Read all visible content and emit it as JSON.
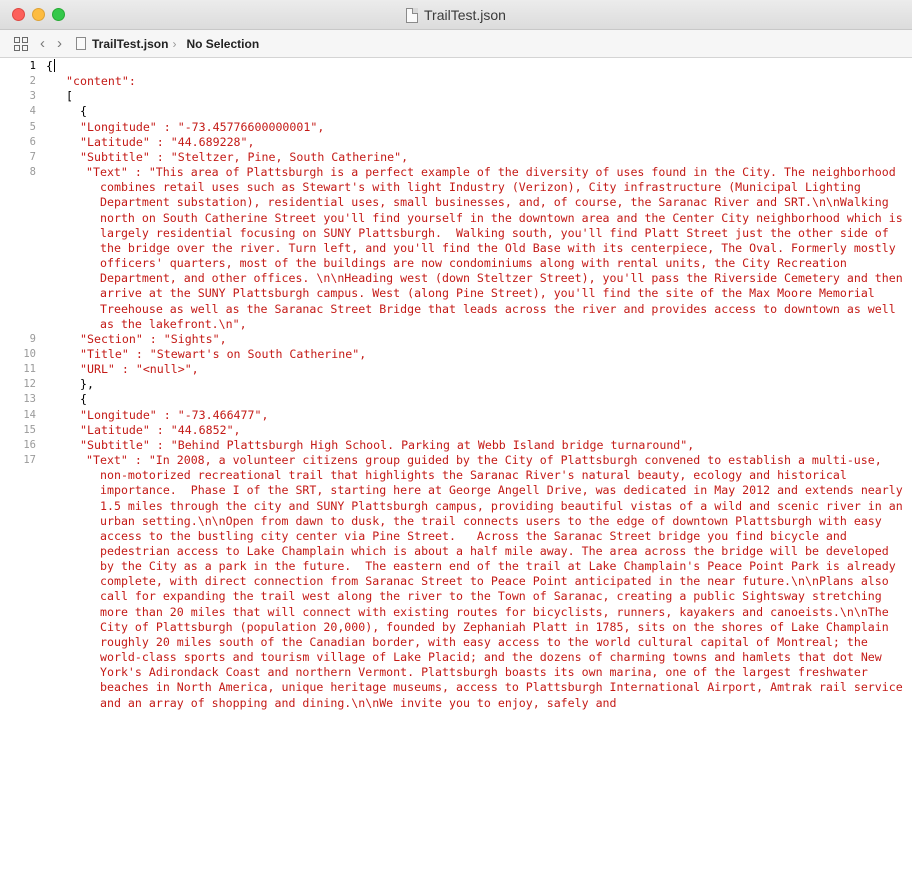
{
  "window": {
    "title": "TrailTest.json"
  },
  "jumpbar": {
    "file": "TrailTest.json",
    "selection": "No Selection"
  },
  "lines": [
    {
      "n": "1",
      "text": "{",
      "plain": true,
      "indent": "none",
      "current": true
    },
    {
      "n": "2",
      "text": "\"content\":",
      "plain": false,
      "indent": "1s"
    },
    {
      "n": "3",
      "text": "[",
      "plain": true,
      "indent": "1s"
    },
    {
      "n": "4",
      "text": "{",
      "plain": true,
      "indent": "1"
    },
    {
      "n": "5",
      "text": "\"Longitude\" : \"-73.45776600000001\",",
      "indent": "1"
    },
    {
      "n": "6",
      "text": "\"Latitude\" : \"44.689228\",",
      "indent": "1"
    },
    {
      "n": "7",
      "text": "\"Subtitle\" : \"Steltzer, Pine, South Catherine\",",
      "indent": "1"
    },
    {
      "n": "8",
      "text": "\"Text\" : \"This area of Plattsburgh is a perfect example of the diversity of uses found in the City. The neighborhood combines retail uses such as Stewart's with light Industry (Verizon), City infrastructure (Municipal Lighting Department substation), residential uses, small businesses, and, of course, the Saranac River and SRT.\\n\\nWalking north on South Catherine Street you'll find yourself in the downtown area and the Center City neighborhood which is largely residential focusing on SUNY Plattsburgh.  Walking south, you'll find Platt Street just the other side of the bridge over the river. Turn left, and you'll find the Old Base with its centerpiece, The Oval. Formerly mostly officers' quarters, most of the buildings are now condominiums along with rental units, the City Recreation Department, and other offices. \\n\\nHeading west (down Steltzer Street), you'll pass the Riverside Cemetery and then arrive at the SUNY Plattsburgh campus. West (along Pine Street), you'll find the site of the Max Moore Memorial Treehouse as well as the Saranac Street Bridge that leads across the river and provides access to downtown as well as the lakefront.\\n\",",
      "indent": "wrap"
    },
    {
      "n": "9",
      "text": "\"Section\" : \"Sights\",",
      "indent": "1"
    },
    {
      "n": "10",
      "text": "\"Title\" : \"Stewart's on South Catherine\",",
      "indent": "1"
    },
    {
      "n": "11",
      "text": "\"URL\" : \"<null>\",",
      "indent": "1"
    },
    {
      "n": "12",
      "text": "},",
      "plain": true,
      "indent": "1"
    },
    {
      "n": "13",
      "text": "{",
      "plain": true,
      "indent": "1"
    },
    {
      "n": "14",
      "text": "\"Longitude\" : \"-73.466477\",",
      "indent": "1"
    },
    {
      "n": "15",
      "text": "\"Latitude\" : \"44.6852\",",
      "indent": "1"
    },
    {
      "n": "16",
      "text": "\"Subtitle\" : \"Behind Plattsburgh High School. Parking at Webb Island bridge turnaround\",",
      "indent": "1"
    },
    {
      "n": "17",
      "text": "\"Text\" : \"In 2008, a volunteer citizens group guided by the City of Plattsburgh convened to establish a multi-use, non-motorized recreational trail that highlights the Saranac River's natural beauty, ecology and historical importance.  Phase I of the SRT, starting here at George Angell Drive, was dedicated in May 2012 and extends nearly 1.5 miles through the city and SUNY Plattsburgh campus, providing beautiful vistas of a wild and scenic river in an urban setting.\\n\\nOpen from dawn to dusk, the trail connects users to the edge of downtown Plattsburgh with easy access to the bustling city center via Pine Street.   Across the Saranac Street bridge you find bicycle and pedestrian access to Lake Champlain which is about a half mile away. The area across the bridge will be developed by the City as a park in the future.  The eastern end of the trail at Lake Champlain's Peace Point Park is already complete, with direct connection from Saranac Street to Peace Point anticipated in the near future.\\n\\nPlans also call for expanding the trail west along the river to the Town of Saranac, creating a public Sightsway stretching more than 20 miles that will connect with existing routes for bicyclists, runners, kayakers and canoeists.\\n\\nThe City of Plattsburgh (population 20,000), founded by Zephaniah Platt in 1785, sits on the shores of Lake Champlain roughly 20 miles south of the Canadian border, with easy access to the world cultural capital of Montreal; the world-class sports and tourism village of Lake Placid; and the dozens of charming towns and hamlets that dot New York's Adirondack Coast and northern Vermont. Plattsburgh boasts its own marina, one of the largest freshwater beaches in North America, unique heritage museums, access to Plattsburgh International Airport, Amtrak rail service and an array of shopping and dining.\\n\\nWe invite you to enjoy, safely and",
      "indent": "wrap"
    }
  ]
}
